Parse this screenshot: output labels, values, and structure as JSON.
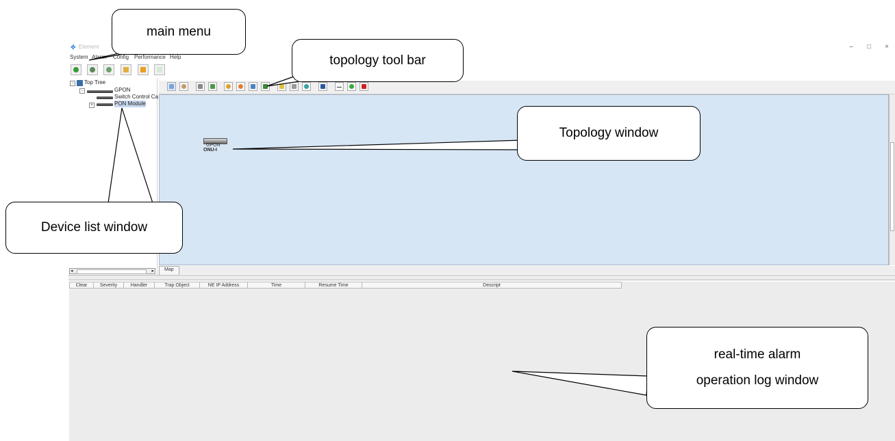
{
  "window": {
    "title": "Element",
    "controls": [
      "–",
      "□",
      "×"
    ]
  },
  "menu": [
    "System",
    "Alarm",
    "Config",
    "Performance",
    "Help"
  ],
  "main_toolbar": {
    "buttons": [
      "topology-icon",
      "device-icon",
      "config-icon",
      "list-icon",
      "alarm-icon",
      "log-icon"
    ]
  },
  "tree": {
    "root": "Top Tree",
    "device": "GPON",
    "children": [
      "Switch Control Ca",
      "PON Module"
    ]
  },
  "topology": {
    "tab": "Map",
    "node_label": "GPON",
    "node_sub": "ONU-I"
  },
  "alarm_table": {
    "columns": [
      "Clear",
      "Severity",
      "Handler",
      "Trap Object",
      "NE IP Address",
      "Time",
      "Resume Time",
      "Descript"
    ]
  },
  "callouts": {
    "main_menu": "main menu",
    "topology_toolbar": "topology tool bar",
    "topology_window": "Topology window",
    "device_list": "Device list window",
    "alarm_line1": "real-time alarm",
    "alarm_line2": "operation log window"
  }
}
